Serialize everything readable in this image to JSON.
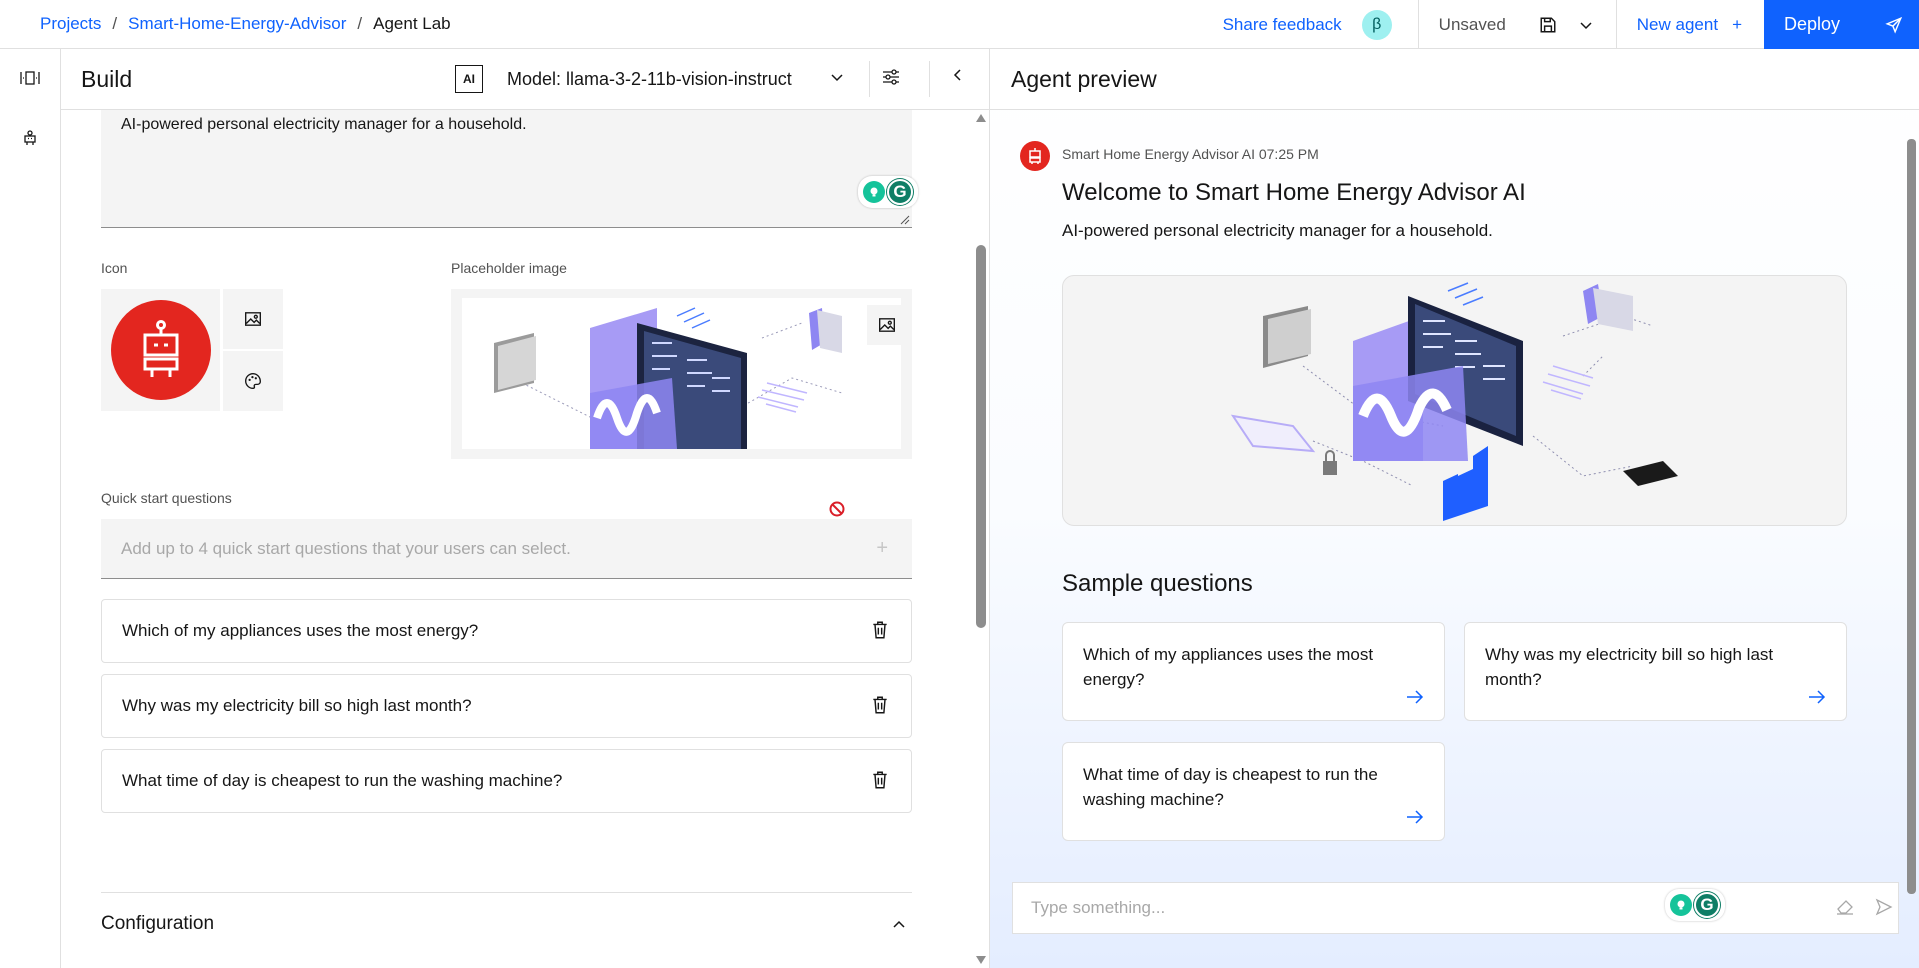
{
  "breadcrumb": {
    "projects": "Projects",
    "sep1": "/",
    "project": "Smart-Home-Energy-Advisor",
    "sep2": "/",
    "current": "Agent Lab"
  },
  "topbar": {
    "share_feedback": "Share feedback",
    "beta_badge": "β",
    "unsaved": "Unsaved",
    "new_agent": "New agent",
    "new_agent_plus": "+",
    "deploy": "Deploy",
    "save_icon": "save-icon",
    "chevron_icon": "chevron-down-icon",
    "deploy_icon": "rocket-icon"
  },
  "rail": {
    "items": [
      {
        "icon": "panel-icon"
      },
      {
        "icon": "agent-icon"
      }
    ]
  },
  "build": {
    "title": "Build",
    "ai_badge": "AI",
    "model_label": "Model: llama-3-2-11b-vision-instruct",
    "description": "AI-powered personal electricity manager for a household.",
    "icon_label": "Icon",
    "placeholder_label": "Placeholder image",
    "quick_start_label": "Quick start questions",
    "quick_start_placeholder": "Add up to 4 quick start questions that your users can select.",
    "quick_start_add": "+",
    "questions": [
      "Which of my appliances uses the most energy?",
      "Why was my electricity bill so high last month?",
      "What time of day is cheapest to run the washing machine?"
    ],
    "configuration": "Configuration"
  },
  "preview": {
    "title": "Agent preview",
    "meta": "Smart Home Energy Advisor AI 07:25 PM",
    "welcome": "Welcome to Smart Home Energy Advisor AI",
    "description": "AI-powered personal electricity manager for a household.",
    "sample_title": "Sample questions",
    "samples": [
      "Which of my appliances uses the most energy?",
      "Why was my electricity bill so high last month?",
      "What time of day is cheapest to run the washing machine?"
    ],
    "input_placeholder": "Type something..."
  },
  "grammarly": {
    "letter": "G"
  },
  "colors": {
    "accent": "#0f62fe",
    "robot_red": "#e3261f",
    "grammarly_green": "#15c39a"
  }
}
